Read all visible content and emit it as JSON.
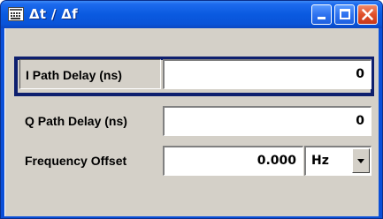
{
  "window": {
    "title": "Δt / Δf",
    "title_bar_color": "#0a5ae0",
    "close_button_color": "#e0502a",
    "controls": {
      "minimize": "minimize-icon",
      "maximize": "maximize-icon",
      "close": "close-icon"
    },
    "app_icon": "window-app-icon"
  },
  "fields": {
    "i_path": {
      "label": "I Path Delay (ns)",
      "value": "0"
    },
    "q_path": {
      "label": "Q Path Delay (ns)",
      "value": "0"
    },
    "freq_offset": {
      "label": "Frequency Offset",
      "value": "0.000",
      "unit": "Hz",
      "unit_icon": "chevron-down-icon"
    }
  },
  "focus": {
    "field": "i_path",
    "color": "#0e1f6e"
  }
}
